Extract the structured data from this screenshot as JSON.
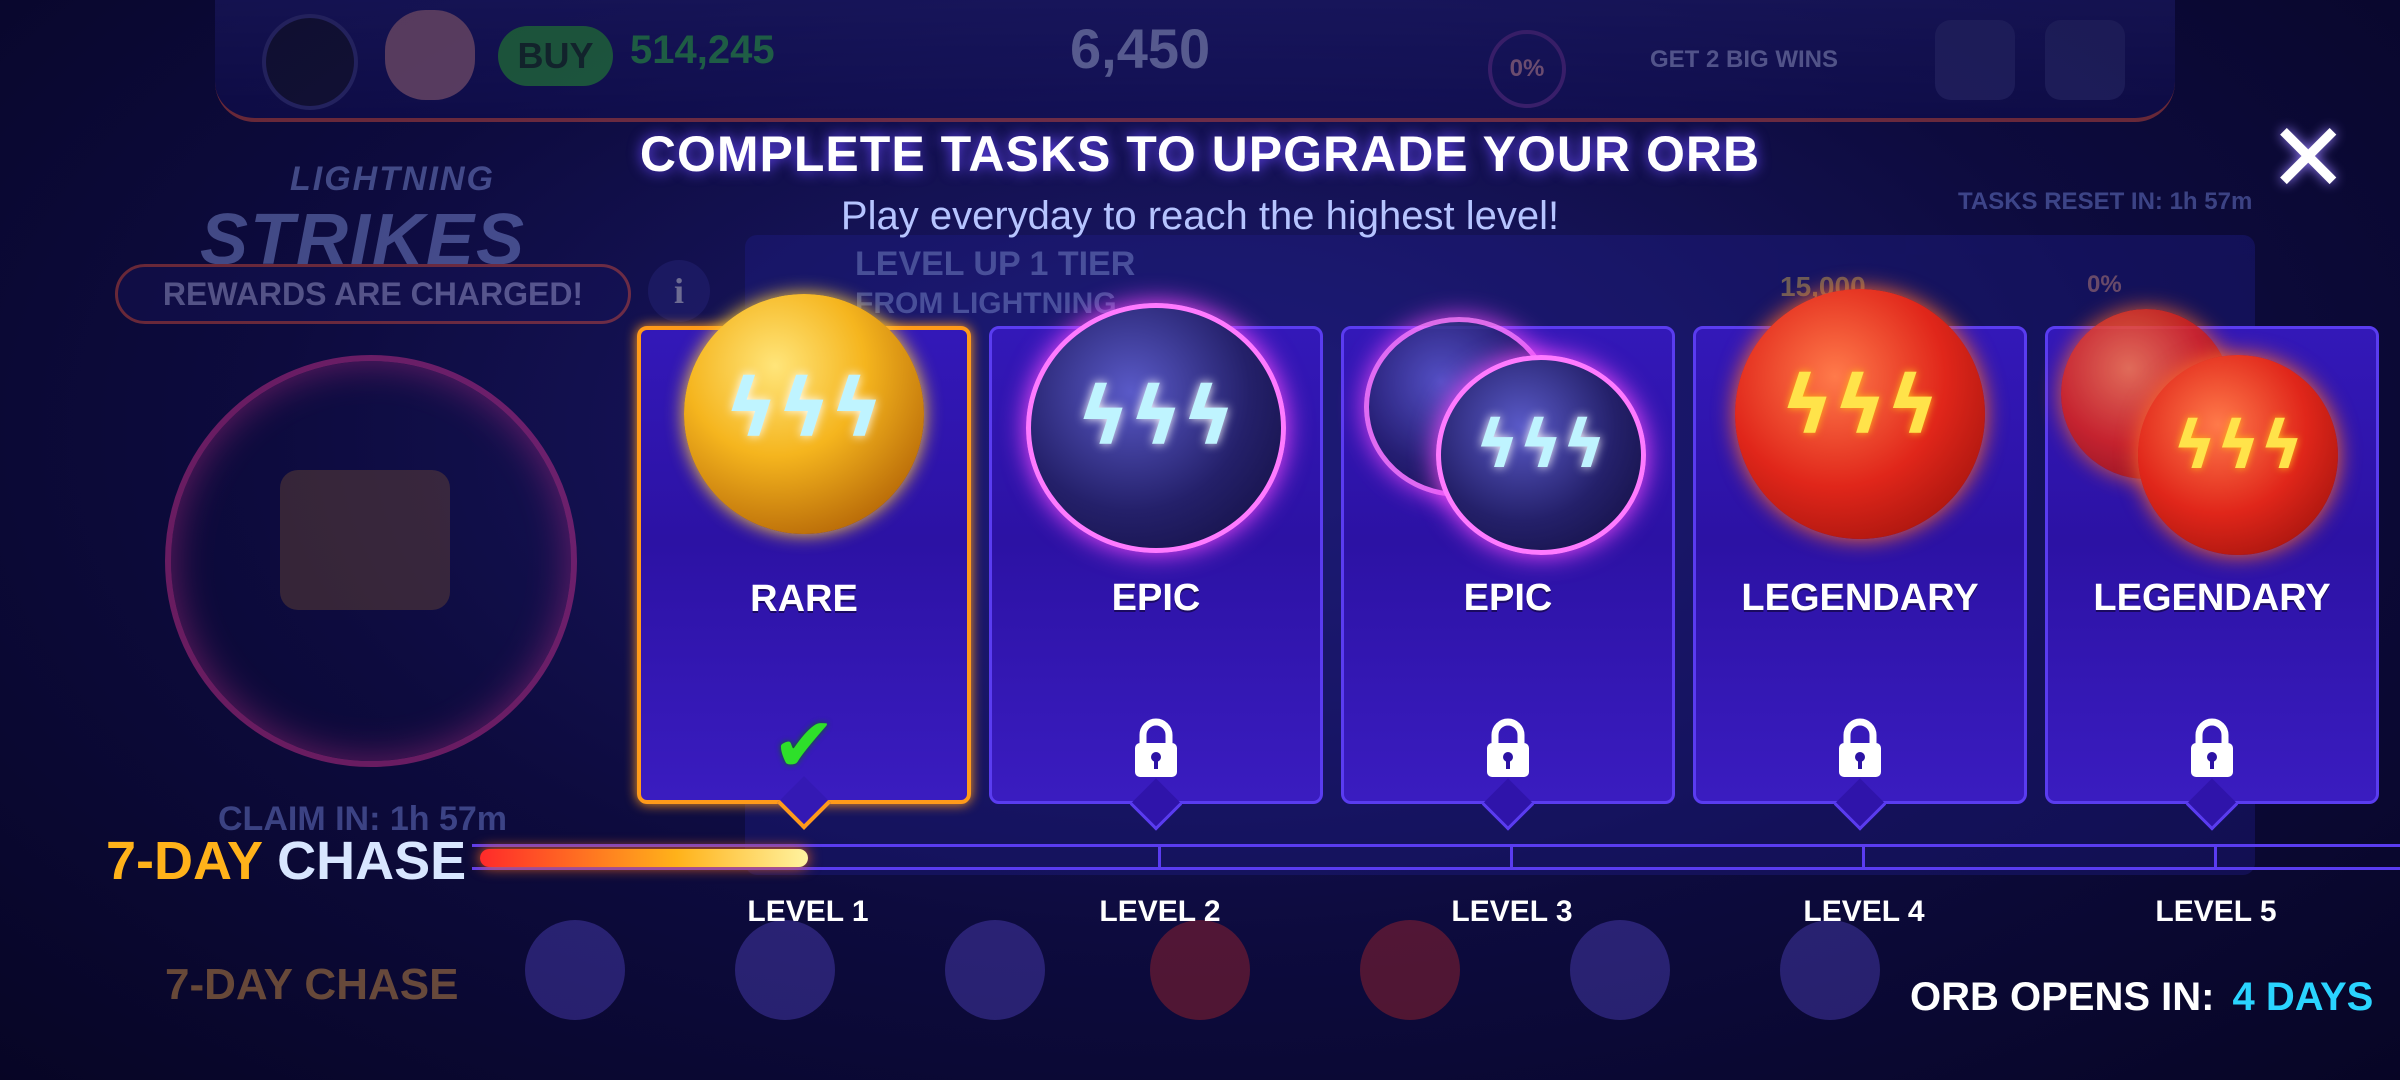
{
  "background": {
    "buy_label": "BUY",
    "coin_balance": "514,245",
    "bolt_balance": "6,450",
    "progress_pct": "0%",
    "quest_text": "GET 2 BIG WINS",
    "logo_line1": "LIGHTNING",
    "logo_line2": "STRIKES",
    "rewards_text": "REWARDS ARE CHARGED!",
    "info_label": "i",
    "claim_in": "CLAIM IN:  1h 57m",
    "chase_label": "7-DAY CHASE",
    "tasks_reset": "TASKS RESET IN:  1h 57m",
    "task_title": "LEVEL UP 1 TIER",
    "task_sub": "FROM LIGHTNING",
    "task_reward": "15,000",
    "task_pct": "0%"
  },
  "header": {
    "title": "COMPLETE TASKS TO UPGRADE YOUR ORB",
    "subtitle": "Play everyday to reach the highest level!",
    "close_glyph": "✕"
  },
  "cards": [
    {
      "rarity": "RARE",
      "status": "completed",
      "status_icon": "check-icon",
      "orb_color": "#f5b51e"
    },
    {
      "rarity": "EPIC",
      "status": "locked",
      "status_icon": "lock-icon",
      "orb_color": "#24206a"
    },
    {
      "rarity": "EPIC",
      "status": "locked",
      "status_icon": "lock-icon",
      "orb_color": "#24206a"
    },
    {
      "rarity": "LEGENDARY",
      "status": "locked",
      "status_icon": "lock-icon",
      "orb_color": "#e0261a"
    },
    {
      "rarity": "LEGENDARY",
      "status": "locked",
      "status_icon": "lock-icon",
      "orb_color": "#e0261a"
    }
  ],
  "icons": {
    "check": "✔",
    "bolts": "ϟϟϟ"
  },
  "chase": {
    "day_part": "7-DAY",
    "word_part": "CHASE",
    "levels": [
      "LEVEL 1",
      "LEVEL 2",
      "LEVEL 3",
      "LEVEL 4",
      "LEVEL 5"
    ],
    "current_level": 1,
    "total_levels": 5
  },
  "footer": {
    "orb_opens_label": "ORB OPENS IN:",
    "orb_opens_value": "4 DAYS"
  },
  "colors": {
    "accent_gold": "#ffb21a",
    "accent_cyan": "#2ad4ff",
    "card_border": "#5a3cf0",
    "active_border": "#ff9a1a"
  }
}
